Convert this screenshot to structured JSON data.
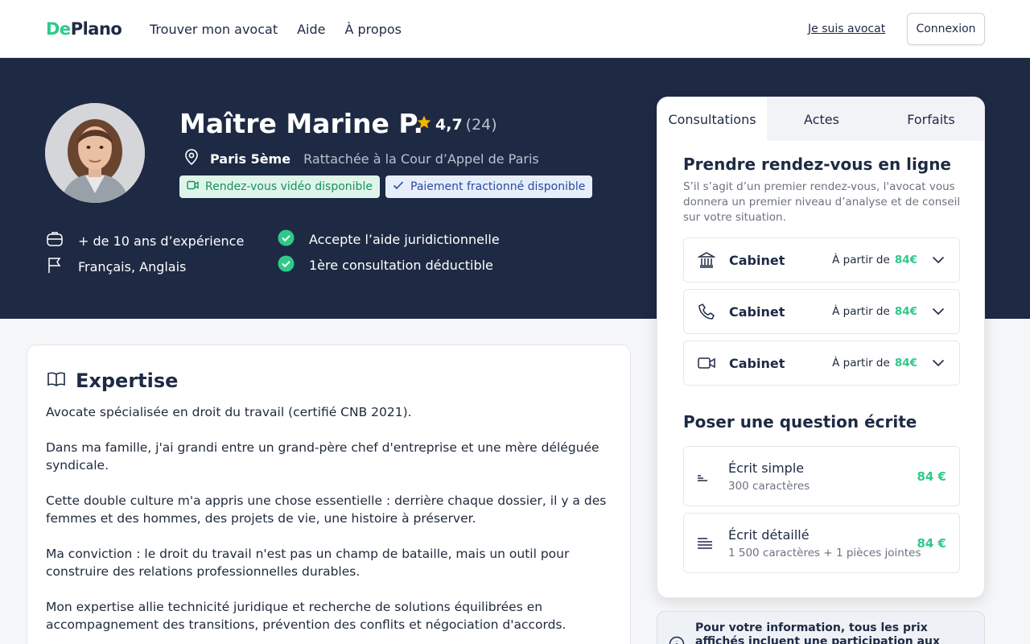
{
  "header": {
    "logo_de": "De",
    "logo_plano": "Plano",
    "nav": [
      "Trouver mon avocat",
      "Aide",
      "À propos"
    ],
    "lawyer_link": "Je suis avocat",
    "login_label": "Connexion"
  },
  "profile": {
    "name": "Maître Marine P.",
    "rating": "4,7",
    "review_count": "(24)",
    "city": "Paris 5ème",
    "court": "Rattachée à la Cour d’Appel de Paris",
    "badge_video": "Rendez-vous vidéo disponible",
    "badge_payment": "Paiement fractionné disponible",
    "experience": "+ de 10 ans d’expérience",
    "languages": "Français, Anglais",
    "legal_aid": "Accepte l’aide juridictionnelle",
    "first_consult": "1ère consultation déductible"
  },
  "expertise": {
    "title": "Expertise",
    "paragraphs": [
      "Avocate spécialisée en droit du travail (certifié CNB 2021).",
      "Dans ma famille, j'ai grandi entre un grand-père chef d'entreprise et une mère déléguée syndicale.",
      "Cette double culture m'a appris une chose essentielle : derrière chaque dossier, il y a des femmes et des hommes, des projets de vie, une histoire à préserver.",
      "Ma conviction : le droit du travail n'est pas un champ de bataille, mais un outil pour construire des relations professionnelles durables.",
      "Mon expertise allie technicité juridique et recherche de solutions équilibrées en accompagnement des transitions, prévention des conflits et négociation d'accords."
    ]
  },
  "booking": {
    "tabs": [
      "Consultations",
      "Actes",
      "Forfaits"
    ],
    "active_tab": "Consultations",
    "appointment_title": "Prendre rendez-vous en ligne",
    "appointment_desc": "S’il s’agit d’un premier rendez-vous, l'avocat vous donnera un premier niveau d’analyse et de conseil sur votre situation.",
    "options": [
      {
        "icon": "bank-icon",
        "label": "Cabinet",
        "from": "À partir de",
        "price": "84€"
      },
      {
        "icon": "phone-icon",
        "label": "Cabinet",
        "from": "À partir de",
        "price": "84€"
      },
      {
        "icon": "video-icon",
        "label": "Cabinet",
        "from": "À partir de",
        "price": "84€"
      }
    ],
    "question_title": "Poser une question écrite",
    "questions": [
      {
        "name": "Écrit simple",
        "sub": "300 caractères",
        "price": "84 €"
      },
      {
        "name": "Écrit détaillé",
        "sub": "1 500 caractères + 1 pièces jointes",
        "price": "84 €"
      }
    ]
  },
  "info": {
    "text": "Pour votre information, tous les prix affichés incluent une participation aux frais de"
  },
  "colors": {
    "navy": "#1e2a44",
    "accent_green": "#2fc98a",
    "star": "#f5b301"
  }
}
